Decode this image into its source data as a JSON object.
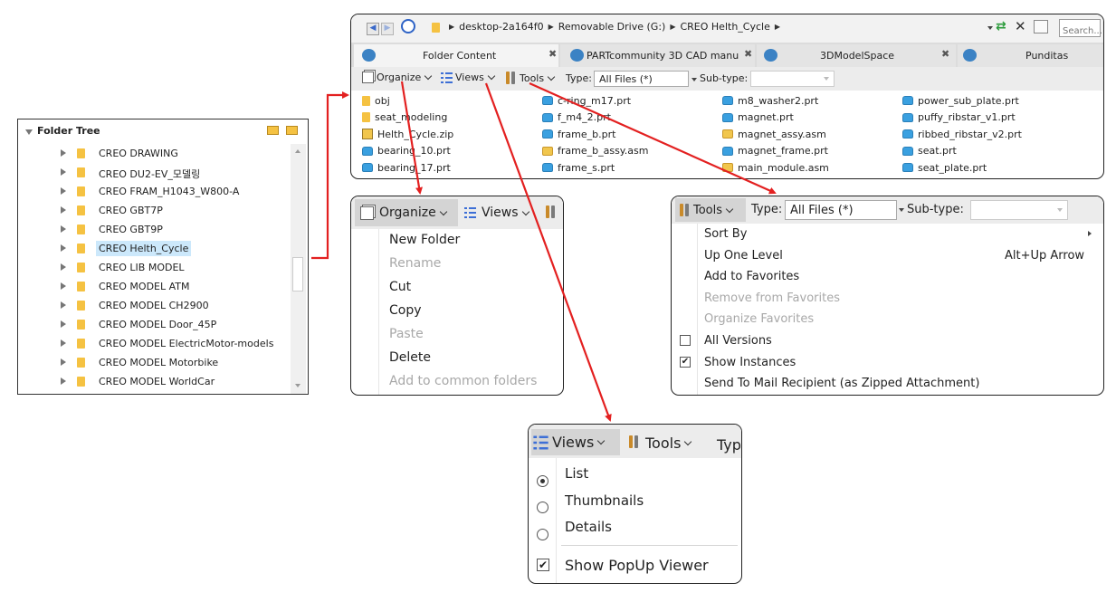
{
  "colors": {
    "arrow": "#e32020",
    "selected": "#cce8fb",
    "accent": "#3d6fd6"
  },
  "folder_tree": {
    "title": "Folder Tree",
    "items": [
      {
        "label": "CREO DRAWING"
      },
      {
        "label": "CREO DU2-EV_모델링"
      },
      {
        "label": "CREO FRAM_H1043_W800-A"
      },
      {
        "label": "CREO GBT7P"
      },
      {
        "label": "CREO GBT9P"
      },
      {
        "label": "CREO Helth_Cycle",
        "selected": true
      },
      {
        "label": "CREO LIB MODEL"
      },
      {
        "label": "CREO MODEL ATM"
      },
      {
        "label": "CREO MODEL CH2900"
      },
      {
        "label": "CREO MODEL Door_45P"
      },
      {
        "label": "CREO MODEL ElectricMotor-models"
      },
      {
        "label": "CREO MODEL Motorbike"
      },
      {
        "label": "CREO MODEL WorldCar"
      }
    ]
  },
  "browser": {
    "breadcrumb": [
      "desktop-2a164f0",
      "Removable Drive (G:)",
      "CREO Helth_Cycle"
    ],
    "search_placeholder": "Search...",
    "tabs": [
      {
        "label": "Folder Content"
      },
      {
        "label": "PARTcommunity 3D CAD manu"
      },
      {
        "label": "3DModelSpace"
      },
      {
        "label": "Punditas"
      }
    ],
    "toolbar": {
      "organize": "Organize",
      "views": "Views",
      "tools": "Tools",
      "type_label": "Type:",
      "type_value": "All Files (*)",
      "subtype_label": "Sub-type:"
    },
    "files": [
      {
        "name": "obj",
        "icon": "folder"
      },
      {
        "name": "seat_modeling",
        "icon": "folder"
      },
      {
        "name": "Helth_Cycle.zip",
        "icon": "zip"
      },
      {
        "name": "bearing_10.prt",
        "icon": "part"
      },
      {
        "name": "bearing_17.prt",
        "icon": "part"
      },
      {
        "name": "c-ring_m17.prt",
        "icon": "part"
      },
      {
        "name": "f_m4_2.prt",
        "icon": "part"
      },
      {
        "name": "frame_b.prt",
        "icon": "part"
      },
      {
        "name": "frame_b_assy.asm",
        "icon": "asm"
      },
      {
        "name": "frame_s.prt",
        "icon": "part"
      },
      {
        "name": "m8_washer2.prt",
        "icon": "part"
      },
      {
        "name": "magnet.prt",
        "icon": "part"
      },
      {
        "name": "magnet_assy.asm",
        "icon": "asm"
      },
      {
        "name": "magnet_frame.prt",
        "icon": "part"
      },
      {
        "name": "main_module.asm",
        "icon": "asm"
      },
      {
        "name": "power_sub_plate.prt",
        "icon": "part"
      },
      {
        "name": "puffy_ribstar_v1.prt",
        "icon": "part"
      },
      {
        "name": "ribbed_ribstar_v2.prt",
        "icon": "part"
      },
      {
        "name": "seat.prt",
        "icon": "part"
      },
      {
        "name": "seat_plate.prt",
        "icon": "part"
      }
    ]
  },
  "organize_menu": {
    "header_organize": "Organize",
    "header_views": "Views",
    "items": [
      {
        "label": "New Folder",
        "enabled": true
      },
      {
        "label": "Rename",
        "enabled": false
      },
      {
        "label": "Cut",
        "enabled": true
      },
      {
        "label": "Copy",
        "enabled": true
      },
      {
        "label": "Paste",
        "enabled": false
      },
      {
        "label": "Delete",
        "enabled": true
      },
      {
        "label": "Add to common folders",
        "enabled": false
      }
    ]
  },
  "tools_menu": {
    "header_tools": "Tools",
    "type_label": "Type:",
    "type_value": "All Files (*)",
    "subtype_label": "Sub-type:",
    "items": [
      {
        "label": "Sort By",
        "enabled": true,
        "submenu": true
      },
      {
        "label": "Up One Level",
        "enabled": true,
        "shortcut": "Alt+Up Arrow"
      },
      {
        "label": "Add to Favorites",
        "enabled": true
      },
      {
        "label": "Remove from Favorites",
        "enabled": false
      },
      {
        "label": "Organize Favorites",
        "enabled": false
      },
      {
        "label": "All Versions",
        "enabled": true,
        "checkbox": true,
        "checked": false
      },
      {
        "label": "Show Instances",
        "enabled": true,
        "checkbox": true,
        "checked": true
      },
      {
        "label": "Send To Mail Recipient (as Zipped Attachment)",
        "enabled": true
      }
    ]
  },
  "views_menu": {
    "header_views": "Views",
    "header_tools": "Tools",
    "header_type": "Typ",
    "options": [
      {
        "label": "List",
        "selected": true
      },
      {
        "label": "Thumbnails",
        "selected": false
      },
      {
        "label": "Details",
        "selected": false
      }
    ],
    "popup_viewer": {
      "label": "Show PopUp Viewer",
      "checked": true
    }
  }
}
